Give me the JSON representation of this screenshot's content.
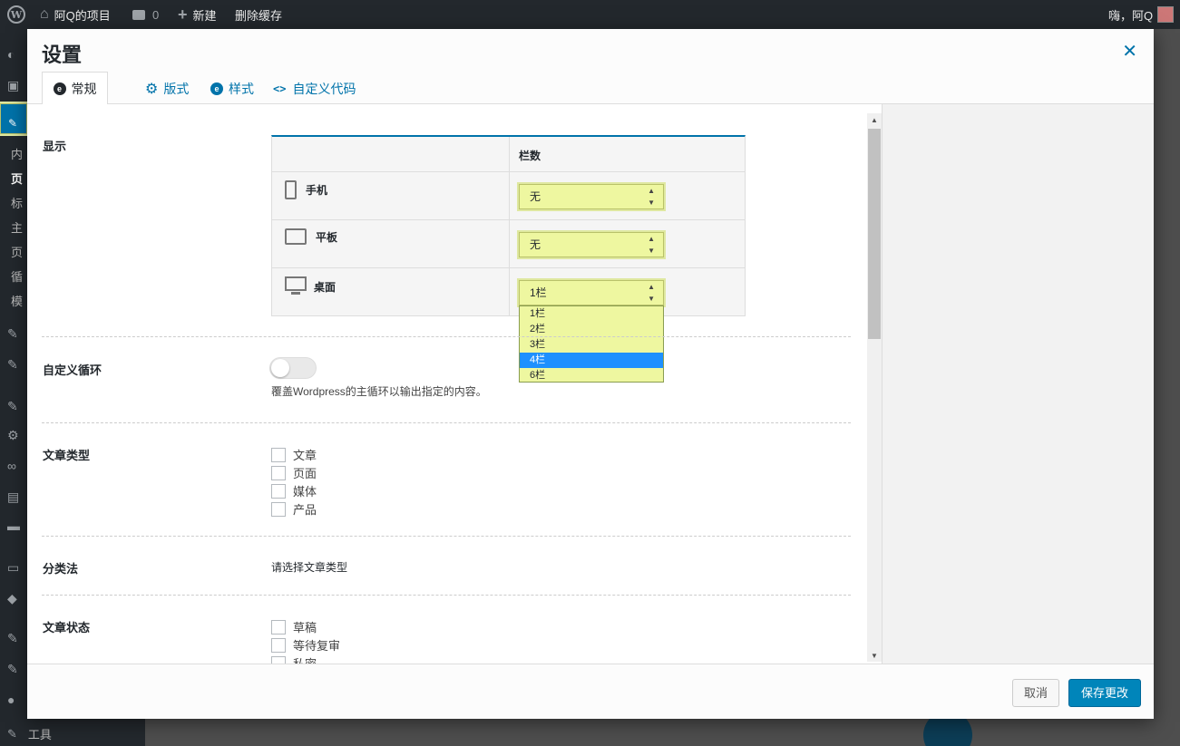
{
  "adminbar": {
    "site_name": "阿Q的项目",
    "comments_count": "0",
    "new_label": "新建",
    "clear_cache_label": "删除缓存",
    "greeting": "嗨，阿Q"
  },
  "sidebar": {
    "items": [
      "内",
      "页",
      "标",
      "主",
      "页",
      "循",
      "模"
    ],
    "tools_label": "工具"
  },
  "modal": {
    "title": "设置",
    "tabs": [
      {
        "label": "常规",
        "icon": "circle-logo-icon"
      },
      {
        "label": "版式",
        "icon": "gear-icon"
      },
      {
        "label": "样式",
        "icon": "circle-logo-icon"
      },
      {
        "label": "自定义代码",
        "icon": "code-icon"
      }
    ],
    "display": {
      "label": "显示",
      "column_header": "栏数",
      "devices": [
        {
          "name": "手机",
          "value": "无"
        },
        {
          "name": "平板",
          "value": "无"
        },
        {
          "name": "桌面",
          "value": "1栏"
        }
      ],
      "dropdown_options": [
        "1栏",
        "2栏",
        "3栏",
        "4栏",
        "6栏"
      ],
      "dropdown_highlighted": "4栏"
    },
    "custom_loop": {
      "label": "自定义循环",
      "enabled": false,
      "description": "覆盖Wordpress的主循环以输出指定的内容。"
    },
    "post_types": {
      "label": "文章类型",
      "options": [
        "文章",
        "页面",
        "媒体",
        "产品"
      ]
    },
    "taxonomy": {
      "label": "分类法",
      "hint": "请选择文章类型"
    },
    "post_status": {
      "label": "文章状态",
      "options": [
        "草稿",
        "等待复审",
        "私密"
      ]
    },
    "footer": {
      "cancel_label": "取消",
      "save_label": "保存更改"
    }
  }
}
